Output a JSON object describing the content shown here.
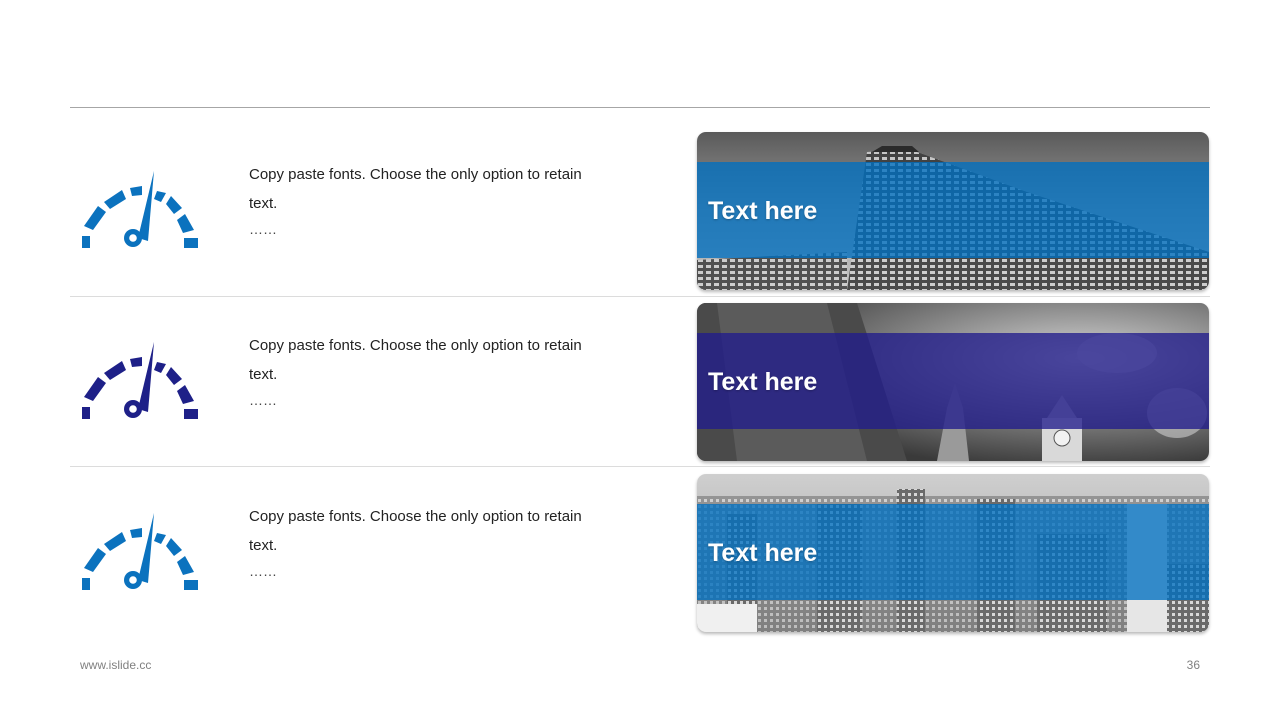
{
  "colors": {
    "accent_blue": "#0070C0",
    "accent_navy": "#1F1A80",
    "divider": "#A6A6A6"
  },
  "rows": [
    {
      "icon": "speedometer-icon",
      "icon_color": "#0B72BE",
      "text_line1": "Copy paste fonts. Choose the only option to retain",
      "text_line2": "text.",
      "ellipsis": "……",
      "banner_label": "Text here",
      "banner_color": "#0070C0",
      "photo": "skyscraper-photo"
    },
    {
      "icon": "speedometer-icon",
      "icon_color": "#1E2088",
      "text_line1": "Copy paste fonts. Choose the only option to retain",
      "text_line2": "text.",
      "ellipsis": "……",
      "banner_label": "Text here",
      "banner_color": "#211C8C",
      "photo": "clocktower-photo"
    },
    {
      "icon": "speedometer-icon",
      "icon_color": "#0B72BE",
      "text_line1": "Copy paste fonts. Choose the only option to retain",
      "text_line2": "text.",
      "ellipsis": "……",
      "banner_label": "Text here",
      "banner_color": "#0070C0",
      "photo": "cityscape-photo"
    }
  ],
  "footer": {
    "website": "www.islide.cc",
    "page_number": "36"
  }
}
